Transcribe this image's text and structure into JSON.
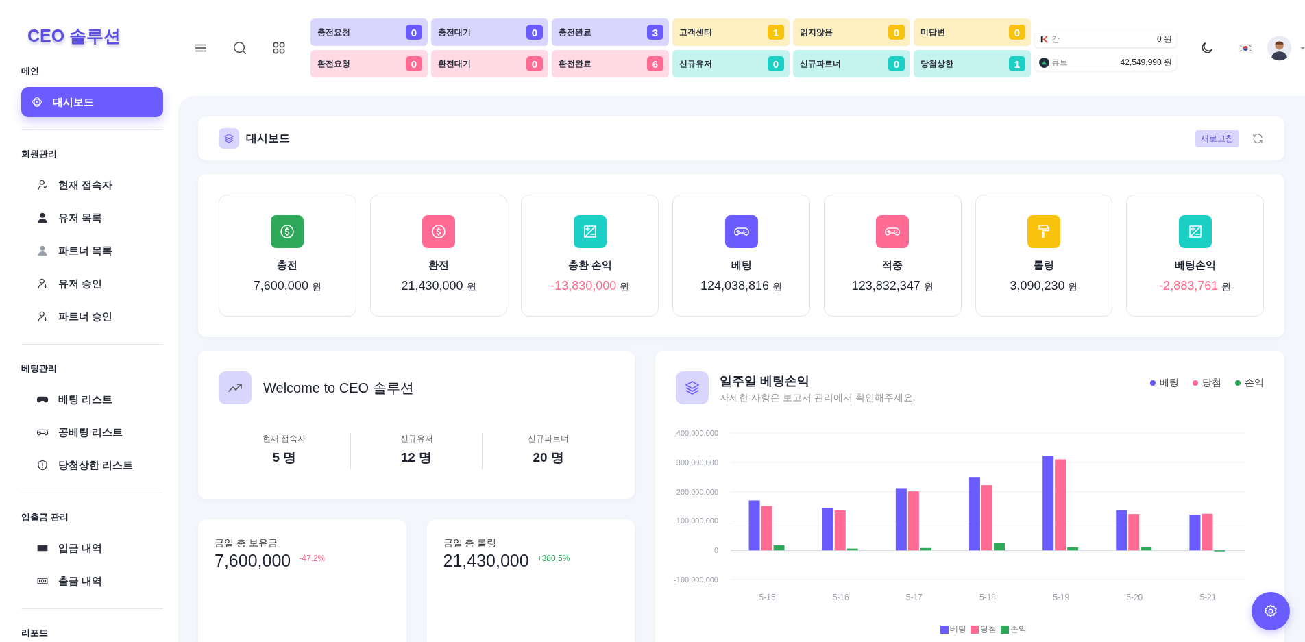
{
  "logo": "CEO 솔루션",
  "sidebar": {
    "sections": [
      {
        "title": "메인",
        "items": [
          {
            "label": "대시보드",
            "kind": "atom",
            "selected": true
          }
        ]
      },
      {
        "title": "회원관리",
        "items": [
          {
            "label": "현재 접속자",
            "kind": "user",
            "selected": false
          },
          {
            "label": "유저 목록",
            "kind": "user-solid",
            "selected": false
          },
          {
            "label": "파트너 목록",
            "kind": "user-grey",
            "selected": false
          },
          {
            "label": "유저 승인",
            "kind": "user-plus",
            "selected": false
          },
          {
            "label": "파트너 승인",
            "kind": "user-plus",
            "selected": false
          }
        ]
      },
      {
        "title": "베팅관리",
        "items": [
          {
            "label": "베팅 리스트",
            "kind": "gamepad-solid",
            "selected": false
          },
          {
            "label": "공베팅 리스트",
            "kind": "gamepad",
            "selected": false
          },
          {
            "label": "당첨상한 리스트",
            "kind": "shield",
            "selected": false
          }
        ]
      },
      {
        "title": "입출금 관리",
        "items": [
          {
            "label": "입금 내역",
            "kind": "money-solid",
            "selected": false
          },
          {
            "label": "출금 내역",
            "kind": "money",
            "selected": false
          }
        ]
      },
      {
        "title": "리포트"
      }
    ]
  },
  "counters": [
    {
      "label": "충전요청",
      "count": "0",
      "color": "#6a5cff"
    },
    {
      "label": "충전대기",
      "count": "0",
      "color": "#6a5cff"
    },
    {
      "label": "충전완료",
      "count": "3",
      "color": "#6a5cff"
    },
    {
      "label": "고객센터",
      "count": "1",
      "color": "#f8c20d"
    },
    {
      "label": "읽지않음",
      "count": "0",
      "color": "#f8c20d"
    },
    {
      "label": "미답변",
      "count": "0",
      "color": "#f8c20d"
    },
    {
      "label": "환전요청",
      "count": "0",
      "color": "#ff6b93"
    },
    {
      "label": "환전대기",
      "count": "0",
      "color": "#ff6b93"
    },
    {
      "label": "환전완료",
      "count": "6",
      "color": "#ff6b93"
    },
    {
      "label": "신규유저",
      "count": "0",
      "color": "#1bcfc4"
    },
    {
      "label": "신규파트너",
      "count": "0",
      "color": "#1bcfc4"
    },
    {
      "label": "당첨상한",
      "count": "1",
      "color": "#1bcfc4"
    }
  ],
  "wallets": [
    {
      "name": "칸",
      "amount": "0 원",
      "kind": "k"
    },
    {
      "name": "큐브",
      "amount": "42,549,990 원",
      "kind": "cube"
    }
  ],
  "header": {
    "title": "대시보드",
    "refresh": "새로고침"
  },
  "stats": [
    {
      "label": "충전",
      "value": "7,600,000",
      "unit": "원",
      "kind": "dollar",
      "color": "#2ea95a",
      "negative": false
    },
    {
      "label": "환전",
      "value": "21,430,000",
      "unit": "원",
      "kind": "dollar",
      "color": "#ff6b93",
      "negative": false
    },
    {
      "label": "충환 손익",
      "value": "-13,830,000",
      "unit": "원",
      "kind": "percent",
      "color": "#1bcfc4",
      "negative": true
    },
    {
      "label": "베팅",
      "value": "124,038,816",
      "unit": "원",
      "kind": "gamepad",
      "color": "#6a5cff",
      "negative": false
    },
    {
      "label": "적중",
      "value": "123,832,347",
      "unit": "원",
      "kind": "gamepad",
      "color": "#ff6b93",
      "negative": false
    },
    {
      "label": "롤링",
      "value": "3,090,230",
      "unit": "원",
      "kind": "roller",
      "color": "#f8c20d",
      "negative": false
    },
    {
      "label": "베팅손익",
      "value": "-2,883,761",
      "unit": "원",
      "kind": "percent",
      "color": "#1bcfc4",
      "negative": true
    }
  ],
  "welcome": {
    "title": "Welcome to CEO 솔루션",
    "metrics": [
      {
        "label": "현재 접속자",
        "value": "5 명"
      },
      {
        "label": "신규유저",
        "value": "12 명"
      },
      {
        "label": "신규파트너",
        "value": "20 명"
      }
    ]
  },
  "totals": [
    {
      "label": "금일 총 보유금",
      "value": "7,600,000",
      "change": "-47.2%",
      "negative": true
    },
    {
      "label": "금일 총 롤링",
      "value": "21,430,000",
      "change": "+380.5%",
      "negative": false
    }
  ],
  "weekly": {
    "title": "일주일 베팅손익",
    "subtitle": "자세한 사항은 보고서 관리에서 확인해주세요.",
    "legend": [
      {
        "label": "베팅",
        "color": "#6a5cff"
      },
      {
        "label": "당첨",
        "color": "#ff6b93"
      },
      {
        "label": "손익",
        "color": "#2ea95a"
      }
    ],
    "chart_data": {
      "type": "bar",
      "categories": [
        "5-15",
        "5-16",
        "5-17",
        "5-18",
        "5-19",
        "5-20",
        "5-21"
      ],
      "series": [
        {
          "name": "베팅",
          "color": "#6a5cff",
          "values": [
            170000000,
            145000000,
            212000000,
            250000000,
            322000000,
            137000000,
            122000000
          ]
        },
        {
          "name": "당첨",
          "color": "#ff6b93",
          "values": [
            151000000,
            136000000,
            201000000,
            222000000,
            310000000,
            124000000,
            125000000
          ]
        },
        {
          "name": "손익",
          "color": "#2ea95a",
          "values": [
            17000000,
            6000000,
            8000000,
            26000000,
            10000000,
            10000000,
            -2000000
          ]
        }
      ],
      "ylim": [
        -100000000,
        400000000
      ],
      "grid": true,
      "legend": true,
      "yticks": [
        {
          "value": 400000000,
          "label": "400,000,000"
        },
        {
          "value": 300000000,
          "label": "300,000,000"
        },
        {
          "value": 200000000,
          "label": "200,000,000"
        },
        {
          "value": 100000000,
          "label": "100,000,000"
        },
        {
          "value": 0,
          "label": "0"
        },
        {
          "value": -100000000,
          "label": "-100,000,000"
        }
      ]
    }
  }
}
